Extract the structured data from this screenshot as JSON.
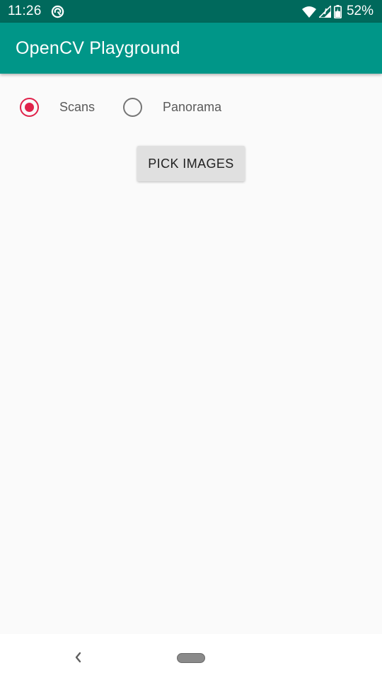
{
  "status_bar": {
    "time": "11:26",
    "battery_text": "52%",
    "icons": [
      "app-notification-icon",
      "wifi-icon",
      "cell-signal-icon",
      "battery-icon"
    ]
  },
  "app_bar": {
    "title": "OpenCV Playground",
    "color": "#009688"
  },
  "mode_selector": {
    "options": [
      {
        "label": "Scans",
        "checked": true
      },
      {
        "label": "Panorama",
        "checked": false
      }
    ],
    "accent_color": "#e0224a"
  },
  "pick_images_button": {
    "label": "PICK IMAGES"
  },
  "nav_bar": {
    "icons": [
      "back-icon",
      "home-pill-icon"
    ]
  }
}
